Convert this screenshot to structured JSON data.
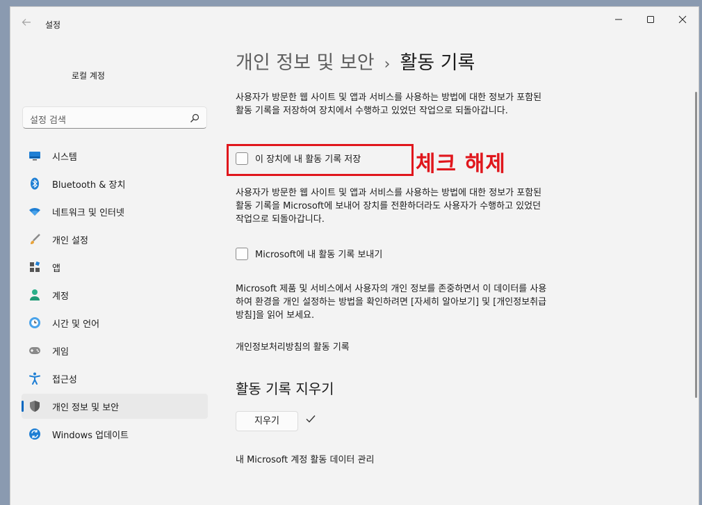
{
  "window": {
    "app_title": "설정"
  },
  "sidebar": {
    "account_name": "로컬 계정",
    "search_placeholder": "설정 검색",
    "items": [
      {
        "label": "시스템",
        "icon": "monitor-icon"
      },
      {
        "label": "Bluetooth & 장치",
        "icon": "bluetooth-icon"
      },
      {
        "label": "네트워크 및 인터넷",
        "icon": "wifi-icon"
      },
      {
        "label": "개인 설정",
        "icon": "brush-icon"
      },
      {
        "label": "앱",
        "icon": "apps-icon"
      },
      {
        "label": "계정",
        "icon": "person-icon"
      },
      {
        "label": "시간 및 언어",
        "icon": "clock-globe-icon"
      },
      {
        "label": "게임",
        "icon": "gamepad-icon"
      },
      {
        "label": "접근성",
        "icon": "accessibility-icon"
      },
      {
        "label": "개인 정보 및 보안",
        "icon": "shield-icon",
        "active": true
      },
      {
        "label": "Windows 업데이트",
        "icon": "update-icon"
      }
    ]
  },
  "main": {
    "breadcrumb_parent": "개인 정보 및 보안",
    "breadcrumb_separator": "›",
    "breadcrumb_current": "활동 기록",
    "para1": "사용자가 방문한 웹 사이트 및 앱과 서비스를 사용하는 방법에 대한 정보가 포함된 활동 기록을 저장하여 장치에서 수행하고 있었던 작업으로 되돌아갑니다.",
    "checkbox1_label": "이 장치에 내 활동 기록 저장",
    "checkbox1_checked": false,
    "annotation": "체크 해제",
    "para2": "사용자가 방문한 웹 사이트 및 앱과 서비스를 사용하는 방법에 대한 정보가 포함된 활동 기록을 Microsoft에 보내어 장치를 전환하더라도 사용자가 수행하고 있었던 작업으로 되돌아갑니다.",
    "checkbox2_label": "Microsoft에 내 활동 기록 보내기",
    "checkbox2_checked": false,
    "para3": "Microsoft 제품 및 서비스에서 사용자의 개인 정보를 존중하면서 이 데이터를 사용하여 환경을 개인 설정하는 방법을 확인하려면 [자세히 알아보기] 및 [개인정보취급방침]을 읽어 보세요.",
    "privacy_link": "개인정보처리방침의 활동 기록",
    "clear_section_title": "활동 기록 지우기",
    "clear_button": "지우기",
    "manage_link": "내 Microsoft 계정 활동 데이터 관리"
  },
  "colors": {
    "accent": "#0067c0",
    "annotation_red": "#e0161c"
  }
}
